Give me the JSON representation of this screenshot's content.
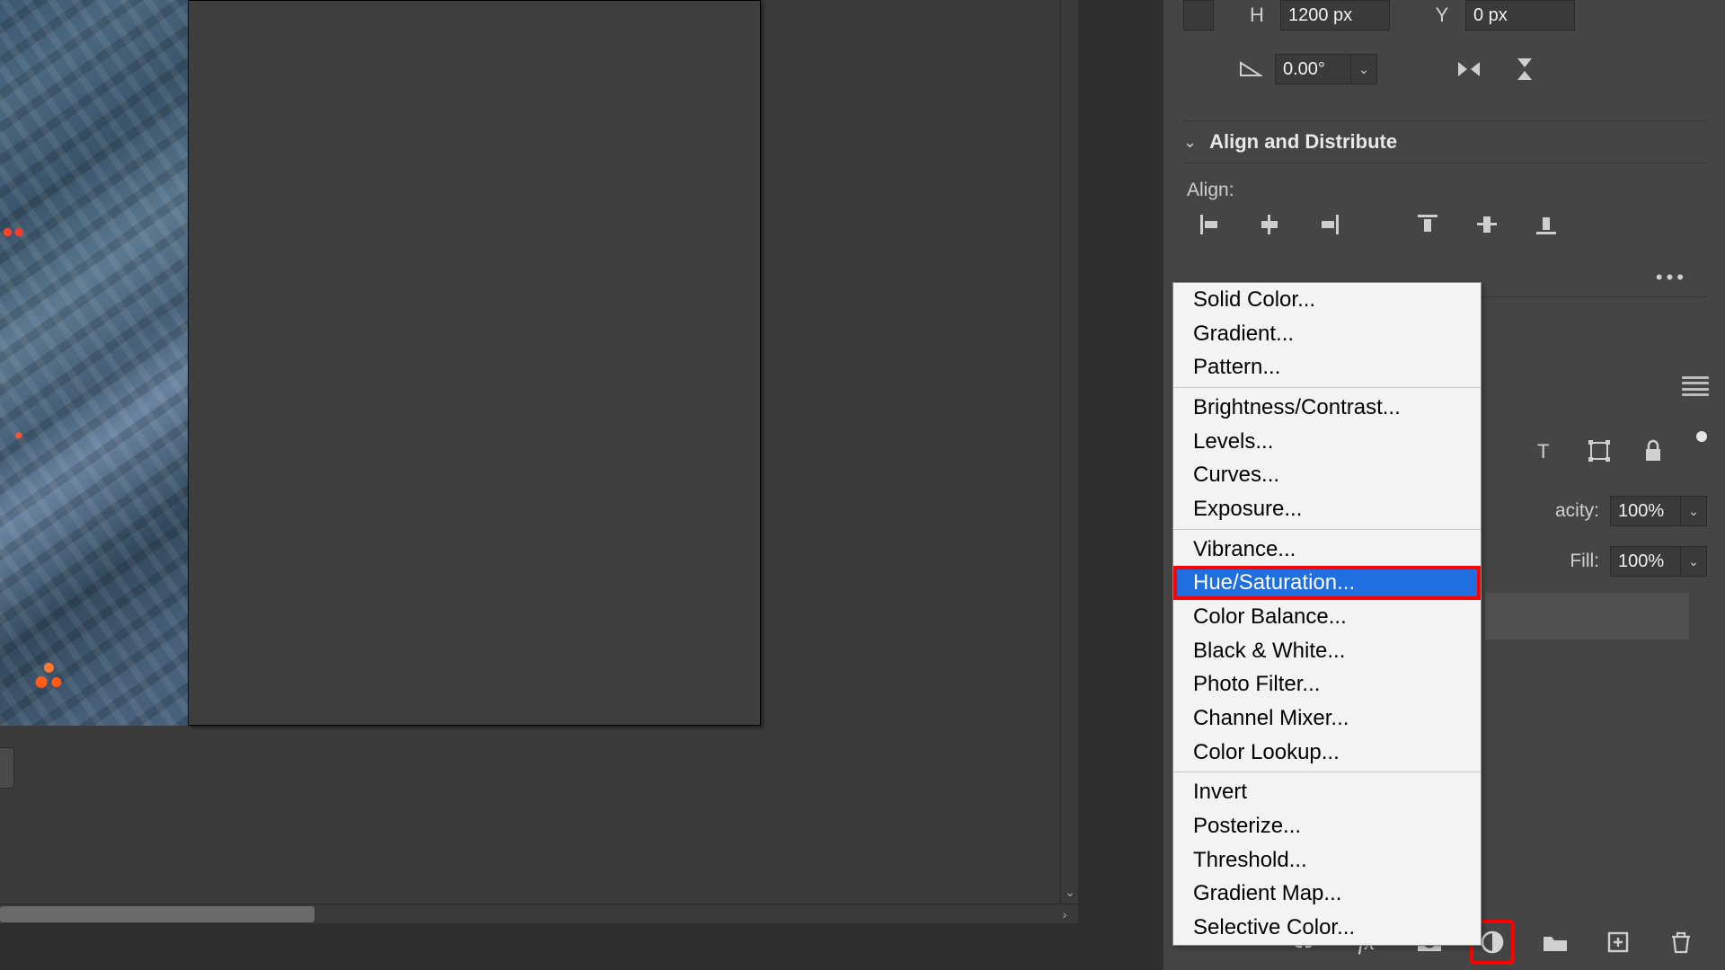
{
  "transform": {
    "h_label": "H",
    "h_value": "1200 px",
    "y_label": "Y",
    "y_value": "0 px",
    "angle_value": "0.00°"
  },
  "properties": {
    "align_section_title": "Align and Distribute",
    "align_label": "Align:"
  },
  "layers_panel": {
    "opacity_label": "acity:",
    "opacity_value": "100%",
    "fill_label": "Fill:",
    "fill_value": "100%"
  },
  "adjustment_menu": {
    "group1": [
      "Solid Color...",
      "Gradient...",
      "Pattern..."
    ],
    "group2": [
      "Brightness/Contrast...",
      "Levels...",
      "Curves...",
      "Exposure..."
    ],
    "group3": [
      "Vibrance...",
      "Hue/Saturation...",
      "Color Balance...",
      "Black & White...",
      "Photo Filter...",
      "Channel Mixer...",
      "Color Lookup..."
    ],
    "group4": [
      "Invert",
      "Posterize...",
      "Threshold...",
      "Gradient Map...",
      "Selective Color..."
    ],
    "highlighted": "Hue/Saturation..."
  },
  "bottom_bar": {
    "fx_label": "fx"
  }
}
